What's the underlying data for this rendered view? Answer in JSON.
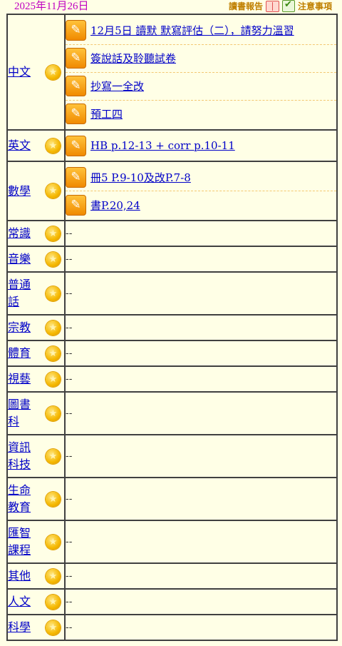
{
  "header": {
    "date": "2025年11月26日",
    "reading_report_label": "讀書報告",
    "notice_label": "注意事項"
  },
  "icons": {
    "star": "star-icon",
    "task": "pencil-note-icon",
    "book": "book-icon",
    "notice": "checklist-icon"
  },
  "colors": {
    "background": "#FFFFE6",
    "link": "#0000C8",
    "date": "#C000C0",
    "top_link": "#C08000",
    "star": "#F5B800",
    "task_icon": "#F08A00"
  },
  "empty_marker": "--",
  "subjects": [
    {
      "name": "中文",
      "tasks": [
        "12月5日 讀默 默寫評估（二），請努力溫習",
        "簽說話及聆聽試卷",
        "抄寫一全改",
        "預工四"
      ]
    },
    {
      "name": "英文",
      "tasks": [
        "HB p.12-13 + corr p.10-11"
      ]
    },
    {
      "name": "數學",
      "tasks": [
        "冊5 P.9-10及改P.7-8",
        "書P.20,24"
      ]
    },
    {
      "name": "常識",
      "tasks": []
    },
    {
      "name": "音樂",
      "tasks": []
    },
    {
      "name": "普通話",
      "tasks": []
    },
    {
      "name": "宗教",
      "tasks": []
    },
    {
      "name": "體育",
      "tasks": []
    },
    {
      "name": "視藝",
      "tasks": []
    },
    {
      "name": "圖書科",
      "tasks": []
    },
    {
      "name": "資訊科技",
      "tasks": []
    },
    {
      "name": "生命教育",
      "tasks": []
    },
    {
      "name": "匯智課程",
      "tasks": []
    },
    {
      "name": "其他",
      "tasks": []
    },
    {
      "name": "人文",
      "tasks": []
    },
    {
      "name": "科學",
      "tasks": []
    }
  ]
}
